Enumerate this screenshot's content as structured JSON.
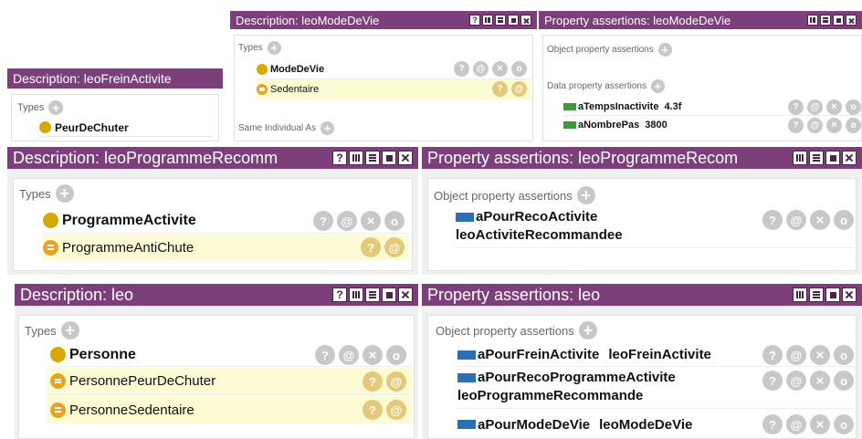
{
  "common": {
    "types_label": "Types",
    "object_props_label": "Object property assertions",
    "data_props_label": "Data property assertions",
    "same_individual_label": "Same Individual As",
    "plus": "+",
    "help": "?",
    "annotate": "@",
    "delete": "×",
    "edit": "o"
  },
  "panel_frein": {
    "title": "Description: leoFreinActivite",
    "types": [
      {
        "label": "PeurDeChuter"
      }
    ]
  },
  "panel_mode_desc": {
    "title": "Description: leoModeDeVie",
    "types": [
      {
        "label": "ModeDeVie"
      },
      {
        "label": "Sedentaire"
      }
    ]
  },
  "panel_mode_props": {
    "title": "Property assertions: leoModeDeVie",
    "data_props": [
      {
        "property": "aTempsInactivite",
        "value": "4.3f"
      },
      {
        "property": "aNombrePas",
        "value": "3800"
      }
    ]
  },
  "panel_prog_desc": {
    "title": "Description: leoProgrammeRecomm",
    "types": [
      {
        "label": "ProgrammeActivite"
      },
      {
        "label": "ProgrammeAntiChute"
      }
    ]
  },
  "panel_prog_props": {
    "title": "Property assertions: leoProgrammeRecom",
    "object_props": [
      {
        "property": "aPourRecoActivite",
        "value": "leoActiviteRecommandee"
      }
    ]
  },
  "panel_leo_desc": {
    "title": "Description: leo",
    "types": [
      {
        "label": "Personne"
      },
      {
        "label": "PersonnePeurDeChuter"
      },
      {
        "label": "PersonneSedentaire"
      }
    ]
  },
  "panel_leo_props": {
    "title": "Property assertions: leo",
    "object_props": [
      {
        "property": "aPourFreinActivite",
        "value": "leoFreinActivite"
      },
      {
        "property": "aPourRecoProgrammeActivite",
        "value": "leoProgrammeRecommande"
      },
      {
        "property": "aPourModeDeVie",
        "value": "leoModeDeVie"
      }
    ]
  },
  "colors": {
    "titlebar": "#7d3f7b",
    "class_dot": "#d8a800",
    "inferred_row": "#fdfbd4",
    "data_prop": "#3f9a3f",
    "object_prop": "#2870b4"
  }
}
